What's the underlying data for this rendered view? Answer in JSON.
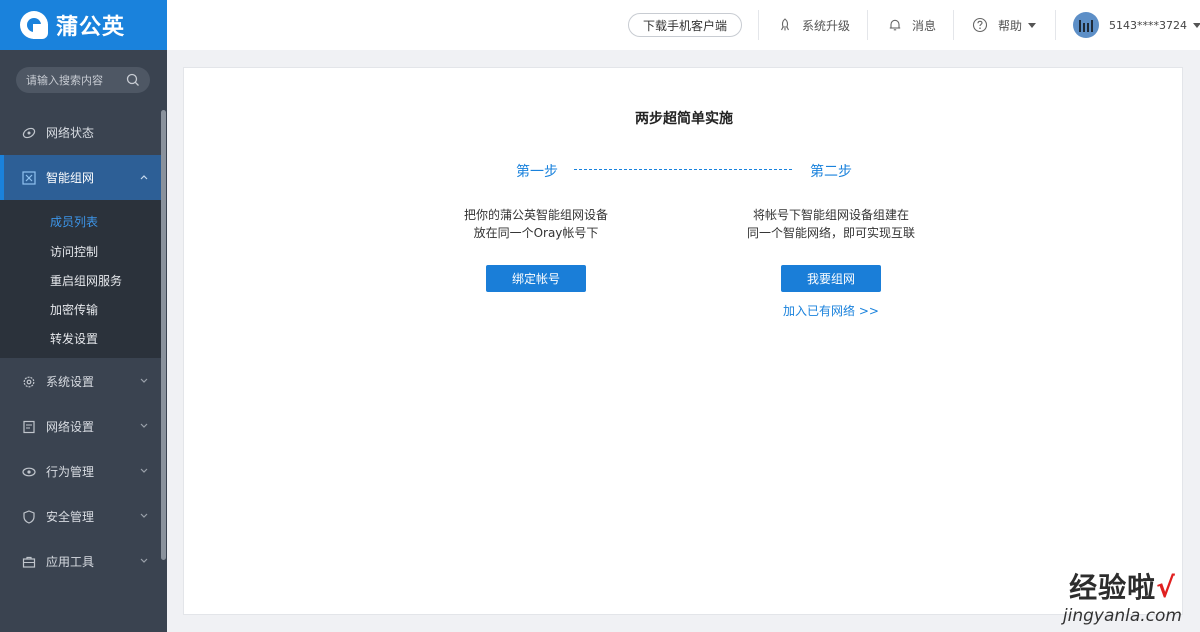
{
  "brand": {
    "name": "蒲公英"
  },
  "search": {
    "placeholder": "请输入搜索内容"
  },
  "sidebar": {
    "items": [
      {
        "label": "网络状态"
      },
      {
        "label": "智能组网"
      },
      {
        "label": "系统设置"
      },
      {
        "label": "网络设置"
      },
      {
        "label": "行为管理"
      },
      {
        "label": "安全管理"
      },
      {
        "label": "应用工具"
      }
    ],
    "submenu": [
      {
        "label": "成员列表"
      },
      {
        "label": "访问控制"
      },
      {
        "label": "重启组网服务"
      },
      {
        "label": "加密传输"
      },
      {
        "label": "转发设置"
      }
    ]
  },
  "header": {
    "download_label": "下载手机客户端",
    "upgrade_label": "系统升级",
    "messages_label": "消息",
    "help_label": "帮助",
    "account": "5143****3724"
  },
  "main": {
    "title": "两步超简单实施",
    "step1": {
      "label": "第一步",
      "line1": "把你的蒲公英智能组网设备",
      "line2": "放在同一个Oray帐号下",
      "button": "绑定帐号"
    },
    "step2": {
      "label": "第二步",
      "line1": "将帐号下智能组网设备组建在",
      "line2": "同一个智能网络，即可实现互联",
      "button": "我要组网",
      "link": "加入已有网络 >>"
    }
  },
  "watermark": {
    "title": "经验啦",
    "check": "√",
    "url": "jingyanla.com"
  },
  "colors": {
    "accent": "#1a82dc",
    "sidebar_bg": "#3a4350",
    "submenu_bg": "#2b323b"
  }
}
